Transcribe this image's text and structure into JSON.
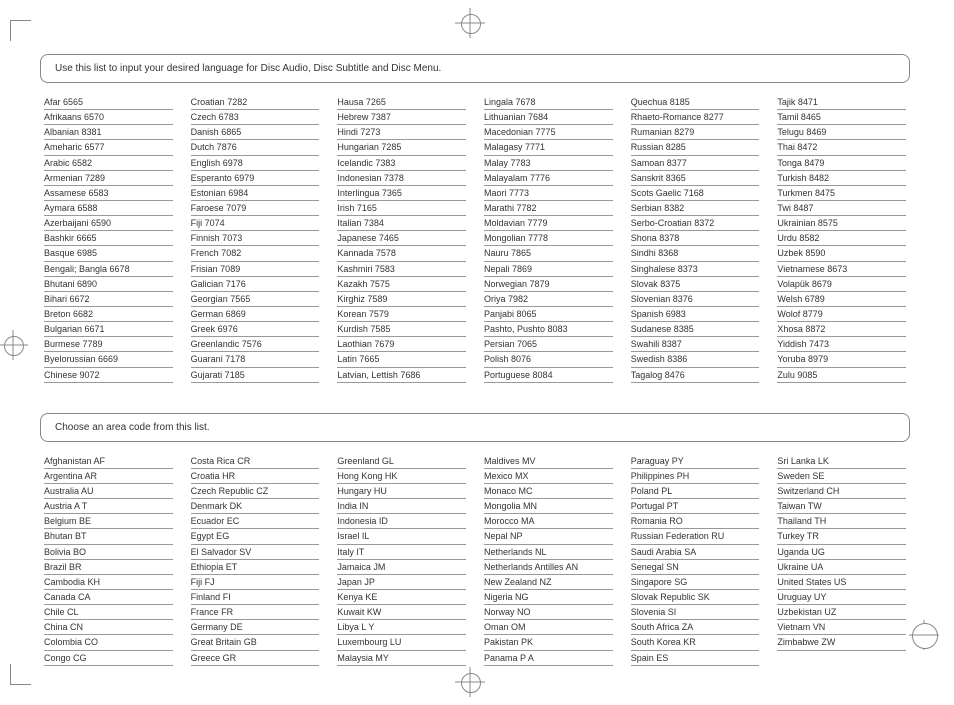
{
  "section1": {
    "header": "Use this list to input your desired language for Disc  Audio, Disc Subtitle and Disc Menu.",
    "columns": [
      [
        {
          "name": "Afar",
          "code": "6565"
        },
        {
          "name": "Afrikaans",
          "code": "6570"
        },
        {
          "name": "Albanian",
          "code": "8381"
        },
        {
          "name": "Ameharic",
          "code": "6577"
        },
        {
          "name": "Arabic",
          "code": "6582"
        },
        {
          "name": "Armenian",
          "code": "7289"
        },
        {
          "name": "Assamese",
          "code": "6583"
        },
        {
          "name": "Aymara",
          "code": "6588"
        },
        {
          "name": "Azerbaijani",
          "code": "6590"
        },
        {
          "name": "Bashkir",
          "code": "6665"
        },
        {
          "name": "Basque",
          "code": "6985"
        },
        {
          "name": "Bengali; Bangla",
          "code": "6678"
        },
        {
          "name": "Bhutani",
          "code": "6890"
        },
        {
          "name": "Bihari",
          "code": "6672"
        },
        {
          "name": "Breton",
          "code": "6682"
        },
        {
          "name": "Bulgarian",
          "code": "6671"
        },
        {
          "name": "Burmese",
          "code": "7789"
        },
        {
          "name": "Byelorussian",
          "code": "6669"
        },
        {
          "name": "Chinese",
          "code": "9072"
        }
      ],
      [
        {
          "name": "Croatian",
          "code": "7282"
        },
        {
          "name": "Czech",
          "code": "6783"
        },
        {
          "name": "Danish",
          "code": "6865"
        },
        {
          "name": "Dutch",
          "code": "7876"
        },
        {
          "name": "English",
          "code": "6978"
        },
        {
          "name": "Esperanto",
          "code": "6979"
        },
        {
          "name": "Estonian",
          "code": "6984"
        },
        {
          "name": "Faroese",
          "code": "7079"
        },
        {
          "name": "Fiji",
          "code": "7074"
        },
        {
          "name": "Finnish",
          "code": "7073"
        },
        {
          "name": "French",
          "code": "7082"
        },
        {
          "name": "Frisian",
          "code": "7089"
        },
        {
          "name": "Galician",
          "code": "7176"
        },
        {
          "name": "Georgian",
          "code": "7565"
        },
        {
          "name": "German",
          "code": "6869"
        },
        {
          "name": "Greek",
          "code": "6976"
        },
        {
          "name": "Greenlandic",
          "code": "7576"
        },
        {
          "name": "Guarani",
          "code": "7178"
        },
        {
          "name": "Gujarati",
          "code": "7185"
        }
      ],
      [
        {
          "name": "Hausa",
          "code": "7265"
        },
        {
          "name": "Hebrew",
          "code": "7387"
        },
        {
          "name": "Hindi",
          "code": "7273"
        },
        {
          "name": "Hungarian",
          "code": "7285"
        },
        {
          "name": "Icelandic",
          "code": "7383"
        },
        {
          "name": "Indonesian",
          "code": "7378"
        },
        {
          "name": "Interlingua",
          "code": "7365"
        },
        {
          "name": "Irish",
          "code": "7165"
        },
        {
          "name": "Italian",
          "code": "7384"
        },
        {
          "name": "Japanese",
          "code": "7465"
        },
        {
          "name": "Kannada",
          "code": "7578"
        },
        {
          "name": "Kashmiri",
          "code": "7583"
        },
        {
          "name": "Kazakh",
          "code": "7575"
        },
        {
          "name": "Kirghiz",
          "code": "7589"
        },
        {
          "name": "Korean",
          "code": "7579"
        },
        {
          "name": "Kurdish",
          "code": "7585"
        },
        {
          "name": "Laothian",
          "code": "7679"
        },
        {
          "name": "Latin",
          "code": "7665"
        },
        {
          "name": "Latvian, Lettish",
          "code": "7686"
        }
      ],
      [
        {
          "name": "Lingala",
          "code": "7678"
        },
        {
          "name": "Lithuanian",
          "code": "7684"
        },
        {
          "name": "Macedonian",
          "code": "7775"
        },
        {
          "name": "Malagasy",
          "code": "7771"
        },
        {
          "name": "Malay",
          "code": "7783"
        },
        {
          "name": "Malayalam",
          "code": "7776"
        },
        {
          "name": "Maori",
          "code": "7773"
        },
        {
          "name": "Marathi",
          "code": "7782"
        },
        {
          "name": "Moldavian",
          "code": "7779"
        },
        {
          "name": "Mongolian",
          "code": "7778"
        },
        {
          "name": "Nauru",
          "code": "7865"
        },
        {
          "name": "Nepali",
          "code": "7869"
        },
        {
          "name": "Norwegian",
          "code": "7879"
        },
        {
          "name": "Oriya",
          "code": "7982"
        },
        {
          "name": "Panjabi",
          "code": "8065"
        },
        {
          "name": "Pashto, Pushto",
          "code": "8083"
        },
        {
          "name": "Persian",
          "code": "7065"
        },
        {
          "name": "Polish",
          "code": "8076"
        },
        {
          "name": "Portuguese",
          "code": "8084"
        }
      ],
      [
        {
          "name": "Quechua",
          "code": "8185"
        },
        {
          "name": "Rhaeto-Romance",
          "code": "8277"
        },
        {
          "name": "Rumanian",
          "code": "8279"
        },
        {
          "name": "Russian",
          "code": "8285"
        },
        {
          "name": "Samoan",
          "code": "8377"
        },
        {
          "name": "Sanskrit",
          "code": "8365"
        },
        {
          "name": "Scots Gaelic",
          "code": "7168"
        },
        {
          "name": "Serbian",
          "code": "8382"
        },
        {
          "name": "Serbo-Croatian",
          "code": "8372"
        },
        {
          "name": "Shona",
          "code": "8378"
        },
        {
          "name": "Sindhi",
          "code": "8368"
        },
        {
          "name": "Singhalese",
          "code": "8373"
        },
        {
          "name": "Slovak",
          "code": "8375"
        },
        {
          "name": "Slovenian",
          "code": "8376"
        },
        {
          "name": "Spanish",
          "code": "6983"
        },
        {
          "name": "Sudanese",
          "code": "8385"
        },
        {
          "name": "Swahili",
          "code": "8387"
        },
        {
          "name": "Swedish",
          "code": "8386"
        },
        {
          "name": "Tagalog",
          "code": "8476"
        }
      ],
      [
        {
          "name": "Tajik",
          "code": "8471"
        },
        {
          "name": "Tamil",
          "code": "8465"
        },
        {
          "name": "Telugu",
          "code": "8469"
        },
        {
          "name": "Thai",
          "code": "8472"
        },
        {
          "name": "Tonga",
          "code": "8479"
        },
        {
          "name": "Turkish",
          "code": "8482"
        },
        {
          "name": "Turkmen",
          "code": "8475"
        },
        {
          "name": "Twi",
          "code": "8487"
        },
        {
          "name": "Ukrainian",
          "code": "8575"
        },
        {
          "name": "Urdu",
          "code": "8582"
        },
        {
          "name": "Uzbek",
          "code": "8590"
        },
        {
          "name": "Vietnamese",
          "code": "8673"
        },
        {
          "name": "Volapük",
          "code": "8679"
        },
        {
          "name": "Welsh",
          "code": "6789"
        },
        {
          "name": "Wolof",
          "code": "8779"
        },
        {
          "name": "Xhosa",
          "code": "8872"
        },
        {
          "name": "Yiddish",
          "code": "7473"
        },
        {
          "name": "Yoruba",
          "code": "8979"
        },
        {
          "name": "Zulu",
          "code": "9085"
        }
      ]
    ]
  },
  "section2": {
    "header": "Choose an area code from this list.",
    "columns": [
      [
        {
          "name": "Afghanistan",
          "code": "AF"
        },
        {
          "name": "Argentina",
          "code": "AR"
        },
        {
          "name": "Australia",
          "code": "AU"
        },
        {
          "name": "Austria A",
          "code": "T"
        },
        {
          "name": "Belgium",
          "code": "BE"
        },
        {
          "name": "Bhutan",
          "code": "BT"
        },
        {
          "name": "Bolivia",
          "code": "BO"
        },
        {
          "name": "Brazil",
          "code": "BR"
        },
        {
          "name": "Cambodia",
          "code": "KH"
        },
        {
          "name": "Canada",
          "code": "CA"
        },
        {
          "name": "Chile",
          "code": "CL"
        },
        {
          "name": "China",
          "code": "CN"
        },
        {
          "name": "Colombia",
          "code": "CO"
        },
        {
          "name": "Congo",
          "code": "CG"
        }
      ],
      [
        {
          "name": "Costa Rica",
          "code": "CR"
        },
        {
          "name": "Croatia",
          "code": "HR"
        },
        {
          "name": "Czech Republic",
          "code": "CZ"
        },
        {
          "name": "Denmark",
          "code": "DK"
        },
        {
          "name": "Ecuador",
          "code": "EC"
        },
        {
          "name": "Egypt",
          "code": "EG"
        },
        {
          "name": "El Salvador",
          "code": "SV"
        },
        {
          "name": "Ethiopia",
          "code": "ET"
        },
        {
          "name": "Fiji",
          "code": "FJ"
        },
        {
          "name": "Finland",
          "code": "FI"
        },
        {
          "name": "France",
          "code": "FR"
        },
        {
          "name": "Germany",
          "code": "DE"
        },
        {
          "name": "Great Britain",
          "code": "GB"
        },
        {
          "name": "Greece",
          "code": "GR"
        }
      ],
      [
        {
          "name": "Greenland",
          "code": "GL"
        },
        {
          "name": "Hong Kong",
          "code": "HK"
        },
        {
          "name": "Hungary",
          "code": "HU"
        },
        {
          "name": "India",
          "code": "IN"
        },
        {
          "name": "Indonesia",
          "code": "ID"
        },
        {
          "name": "Israel",
          "code": "IL"
        },
        {
          "name": "Italy",
          "code": "IT"
        },
        {
          "name": "Jamaica",
          "code": "JM"
        },
        {
          "name": "Japan",
          "code": "JP"
        },
        {
          "name": "Kenya",
          "code": "KE"
        },
        {
          "name": "Kuwait",
          "code": "KW"
        },
        {
          "name": "Libya L",
          "code": "Y"
        },
        {
          "name": "Luxembourg",
          "code": "LU"
        },
        {
          "name": "Malaysia",
          "code": "MY"
        }
      ],
      [
        {
          "name": "Maldives",
          "code": "MV"
        },
        {
          "name": "Mexico",
          "code": "MX"
        },
        {
          "name": "Monaco",
          "code": "MC"
        },
        {
          "name": "Mongolia",
          "code": "MN"
        },
        {
          "name": "Morocco",
          "code": "MA"
        },
        {
          "name": "Nepal",
          "code": "NP"
        },
        {
          "name": "Netherlands",
          "code": "NL"
        },
        {
          "name": "Netherlands Antilles",
          "code": "AN"
        },
        {
          "name": "New Zealand",
          "code": "NZ"
        },
        {
          "name": "Nigeria",
          "code": "NG"
        },
        {
          "name": "Norway",
          "code": "NO"
        },
        {
          "name": "Oman",
          "code": "OM"
        },
        {
          "name": "Pakistan",
          "code": "PK"
        },
        {
          "name": "Panama P",
          "code": "A"
        }
      ],
      [
        {
          "name": "Paraguay",
          "code": "PY"
        },
        {
          "name": "Philippines",
          "code": "PH"
        },
        {
          "name": "Poland",
          "code": "PL"
        },
        {
          "name": "Portugal",
          "code": "PT"
        },
        {
          "name": "Romania",
          "code": "RO"
        },
        {
          "name": "Russian Federation",
          "code": "RU"
        },
        {
          "name": "Saudi Arabia",
          "code": "SA"
        },
        {
          "name": "Senegal",
          "code": "SN"
        },
        {
          "name": "Singapore",
          "code": "SG"
        },
        {
          "name": "Slovak Republic",
          "code": "SK"
        },
        {
          "name": "Slovenia",
          "code": "SI"
        },
        {
          "name": "South Africa",
          "code": "ZA"
        },
        {
          "name": "South Korea",
          "code": "KR"
        },
        {
          "name": "Spain",
          "code": "ES"
        }
      ],
      [
        {
          "name": "Sri Lanka",
          "code": "LK"
        },
        {
          "name": "Sweden",
          "code": "SE"
        },
        {
          "name": "Switzerland",
          "code": "CH"
        },
        {
          "name": "Taiwan",
          "code": "TW"
        },
        {
          "name": "Thailand",
          "code": "TH"
        },
        {
          "name": "Turkey",
          "code": "TR"
        },
        {
          "name": "Uganda",
          "code": "UG"
        },
        {
          "name": "Ukraine",
          "code": "UA"
        },
        {
          "name": "United States",
          "code": "US"
        },
        {
          "name": "Uruguay",
          "code": "UY"
        },
        {
          "name": "Uzbekistan",
          "code": "UZ"
        },
        {
          "name": "Vietnam",
          "code": "VN"
        },
        {
          "name": "Zimbabwe",
          "code": "ZW"
        }
      ]
    ]
  }
}
